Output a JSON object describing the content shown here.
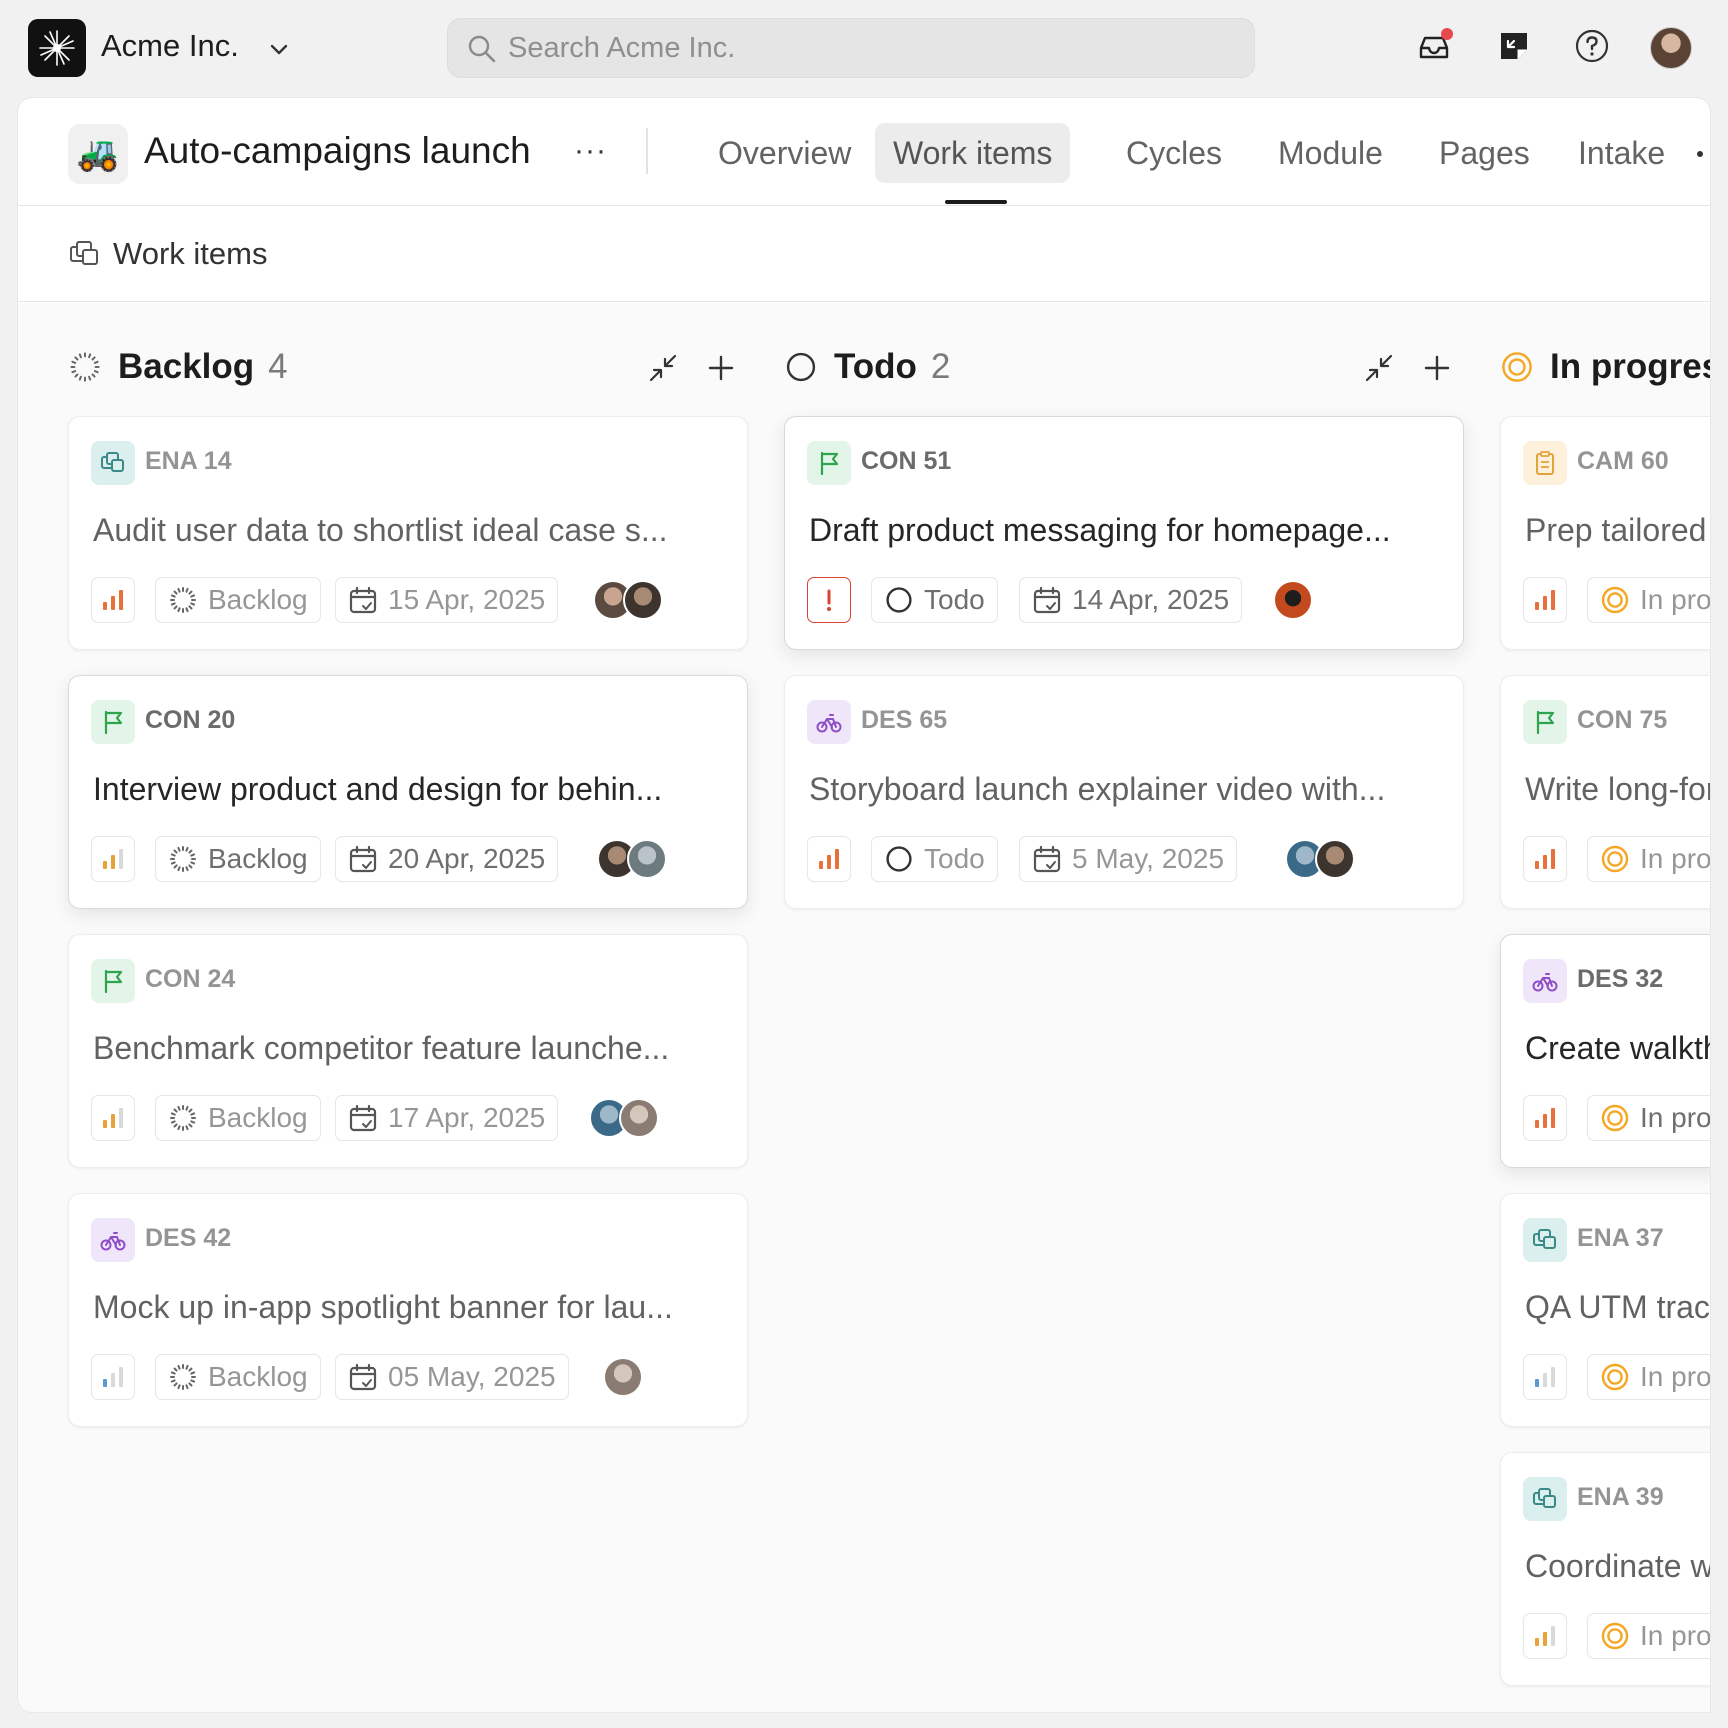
{
  "topbar": {
    "workspace_name": "Acme Inc.",
    "search_placeholder": "Search Acme Inc.",
    "notification_dot_color": "#e5484d"
  },
  "project": {
    "emoji": "🚜",
    "title": "Auto-campaigns launch",
    "more": "···",
    "tabs": [
      {
        "label": "Overview"
      },
      {
        "label": "Work items",
        "active": true
      },
      {
        "label": "Cycles"
      },
      {
        "label": "Module"
      },
      {
        "label": "Pages"
      },
      {
        "label": "Intake"
      }
    ]
  },
  "subheader": {
    "title": "Work items"
  },
  "columns": [
    {
      "title": "Backlog",
      "count": "4",
      "cards": [
        {
          "id": "ENA 14",
          "title": "Audit user data to shortlist ideal case s...",
          "state": "Backlog",
          "date": "15 Apr, 2025",
          "type": "ena"
        },
        {
          "id": "CON 20",
          "title": "Interview product and design for behin...",
          "state": "Backlog",
          "date": "20 Apr, 2025",
          "type": "con"
        },
        {
          "id": "CON 24",
          "title": "Benchmark competitor feature launche...",
          "state": "Backlog",
          "date": "17 Apr, 2025",
          "type": "con"
        },
        {
          "id": "DES 42",
          "title": "Mock up in-app spotlight banner for lau...",
          "state": "Backlog",
          "date": "05 May, 2025",
          "type": "des"
        }
      ]
    },
    {
      "title": "Todo",
      "count": "2",
      "cards": [
        {
          "id": "CON 51",
          "title": "Draft product messaging for homepage...",
          "state": "Todo",
          "date": "14 Apr, 2025",
          "type": "con"
        },
        {
          "id": "DES 65",
          "title": "Storyboard launch explainer video with...",
          "state": "Todo",
          "date": "5 May, 2025",
          "type": "des"
        }
      ]
    },
    {
      "title": "In progres",
      "cards": [
        {
          "id": "CAM 60",
          "title": "Prep tailored c",
          "state": "In pro",
          "type": "cam"
        },
        {
          "id": "CON 75",
          "title": "Write long-forı",
          "state": "In pro",
          "type": "con"
        },
        {
          "id": "DES 32",
          "title": "Create walkthı",
          "state": "In pro",
          "type": "des"
        },
        {
          "id": "ENA 37",
          "title": "QA UTM track",
          "state": "In pro",
          "type": "ena"
        },
        {
          "id": "ENA 39",
          "title": "Coordinate wi",
          "state": "In pro",
          "type": "ena"
        }
      ]
    }
  ],
  "colors": {
    "ena": "#3a8a8a",
    "con": "#2ea44f",
    "des": "#8e4ec6",
    "cam": "#e5a23a",
    "in_progress": "#f5a623",
    "urgent": "#d9432f"
  }
}
